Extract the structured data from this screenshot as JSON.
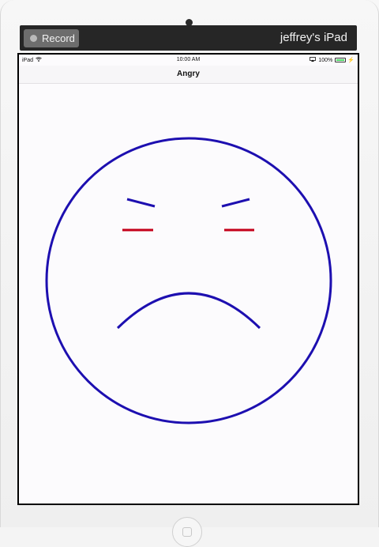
{
  "recorder": {
    "record_label": "Record",
    "device_name": "jeffrey's iPad"
  },
  "status_bar": {
    "carrier": "iPad",
    "time": "10:00 AM",
    "battery": "100%"
  },
  "nav": {
    "title": "Angry"
  },
  "colors": {
    "face_outline": "#1d0fb0",
    "eyebrows": "#1d0fb0",
    "eyes": "#c4001a",
    "mouth": "#1d0fb0",
    "battery": "#4cd964"
  },
  "icons": {
    "wifi": "wifi-icon",
    "airplay": "airplay-icon",
    "battery": "battery-icon",
    "charging": "charging-icon",
    "record_dot": "record-dot-icon"
  }
}
